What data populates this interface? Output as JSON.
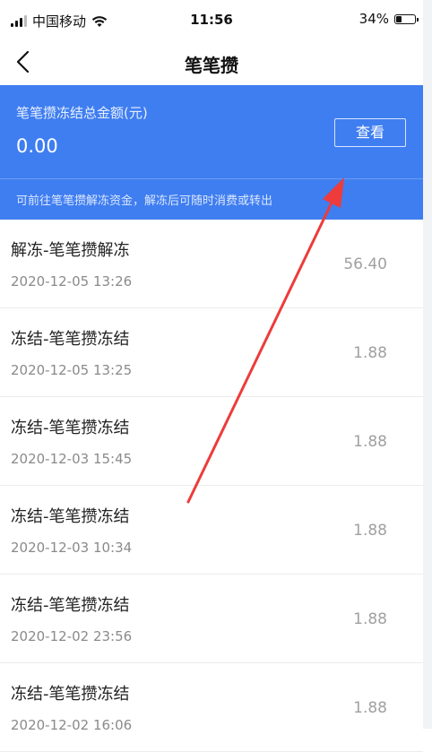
{
  "status_bar": {
    "carrier": "中国移动",
    "time": "11:56",
    "battery": "34%",
    "battery_level": 0.34
  },
  "nav": {
    "title": "笔笔攒"
  },
  "summary": {
    "label": "笔笔攒冻结总金额(元)",
    "amount": "0.00",
    "view_button_label": "查看",
    "hint": "可前往笔笔攒解冻资金，解冻后可随时消费或转出"
  },
  "transactions": [
    {
      "title": "解冻-笔笔攒解冻",
      "time": "2020-12-05 13:26",
      "amount": "56.40"
    },
    {
      "title": "冻结-笔笔攒冻结",
      "time": "2020-12-05 13:25",
      "amount": "1.88"
    },
    {
      "title": "冻结-笔笔攒冻结",
      "time": "2020-12-03 15:45",
      "amount": "1.88"
    },
    {
      "title": "冻结-笔笔攒冻结",
      "time": "2020-12-03 10:34",
      "amount": "1.88"
    },
    {
      "title": "冻结-笔笔攒冻结",
      "time": "2020-12-02 23:56",
      "amount": "1.88"
    },
    {
      "title": "冻结-笔笔攒冻结",
      "time": "2020-12-02 16:06",
      "amount": "1.88"
    }
  ],
  "icons": {
    "back": "chevron-left-icon",
    "signal": "cellular-signal-icon",
    "wifi": "wifi-icon",
    "battery": "battery-icon"
  },
  "colors": {
    "accent": "#3f7ef0",
    "annotation": "#ee3b3b"
  }
}
